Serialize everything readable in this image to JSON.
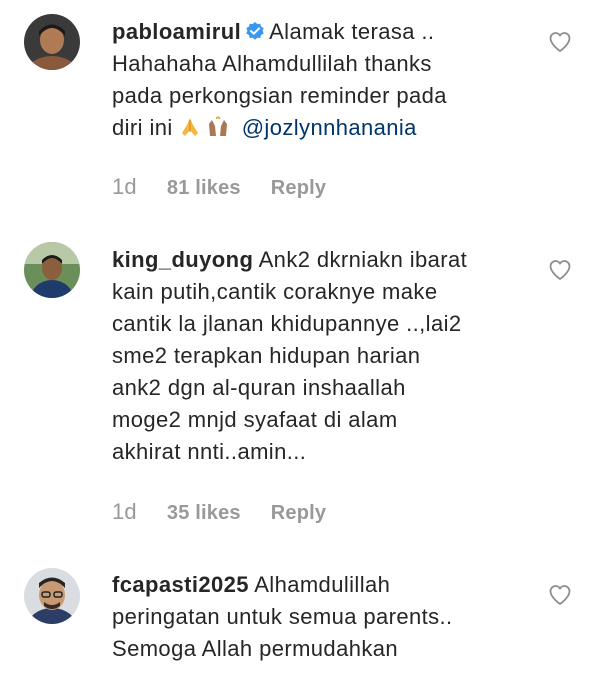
{
  "comments": [
    {
      "username": "pabloamirul",
      "verified": true,
      "text_lines": [
        "Alamak terasa ..",
        "Hahahaha Alhamdullilah thanks",
        "pada perkongsian reminder pada",
        "diri ini"
      ],
      "emojis": [
        "folded-hands",
        "raising-hands"
      ],
      "mention": "@jozlynnhanania",
      "time": "1d",
      "likes": "81 likes",
      "reply": "Reply"
    },
    {
      "username": "king_duyong",
      "verified": false,
      "text_lines": [
        "Ank2 dkrniakn ibarat",
        "kain putih,cantik coraknye make",
        "cantik la jlanan khidupannye ..,lai2",
        "sme2 terapkan hidupan harian",
        "ank2 dgn al-quran inshaallah",
        "moge2 mnjd syafaat di alam",
        "akhirat nnti..amin..."
      ],
      "time": "1d",
      "likes": "35 likes",
      "reply": "Reply"
    },
    {
      "username": "fcapasti2025",
      "verified": false,
      "text_lines": [
        "Alhamdulillah",
        "peringatan untuk semua parents..",
        "Semoga Allah permudahkan"
      ]
    }
  ],
  "colors": {
    "text": "#262626",
    "meta": "#999999",
    "mention": "#003569",
    "verified": "#3897f0"
  },
  "icons": [
    "verified-badge-icon",
    "heart-outline-icon",
    "folded-hands-emoji",
    "raising-hands-emoji"
  ]
}
